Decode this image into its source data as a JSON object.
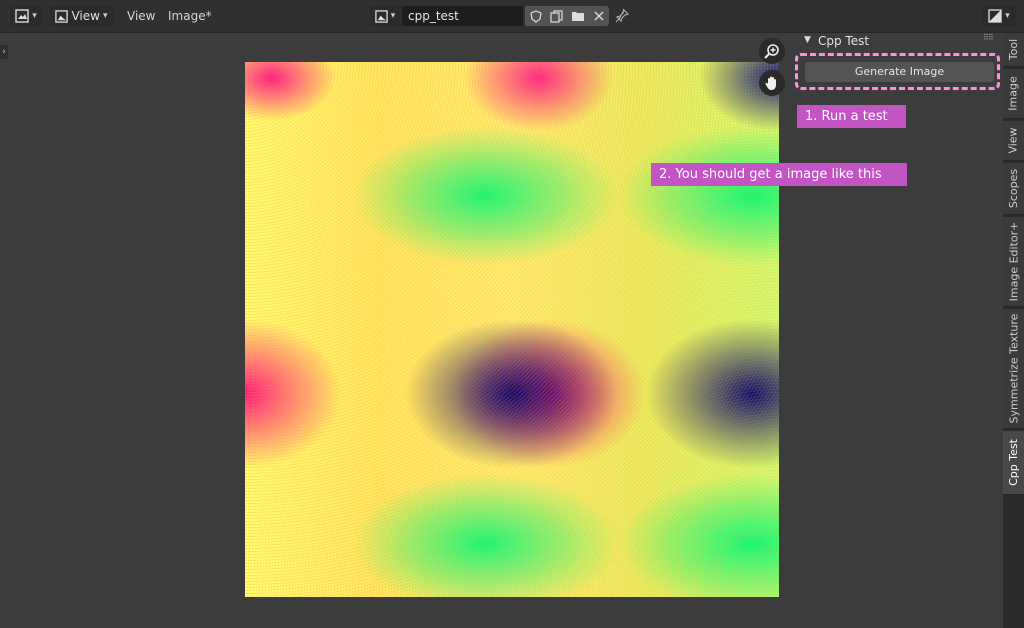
{
  "header": {
    "view_menu": "View",
    "view_label": "View",
    "image_menu": "Image*",
    "image_name": "cpp_test"
  },
  "panel": {
    "title": "Cpp Test",
    "generate_label": "Generate Image"
  },
  "annotations": {
    "step1": "1. Run a test",
    "step2": "2. You should get a image like this"
  },
  "tabs": [
    {
      "label": "Tool"
    },
    {
      "label": "Image"
    },
    {
      "label": "View"
    },
    {
      "label": "Scopes"
    },
    {
      "label": "Image Editor+"
    },
    {
      "label": "Symmetrize Texture"
    },
    {
      "label": "Cpp Test"
    }
  ],
  "colors": {
    "annotation_bg": "#c254c4",
    "highlight": "#ff8fe6"
  },
  "icons": {
    "editor_type": "image-editor-icon",
    "zoom": "zoom-in-icon",
    "pan": "hand-icon"
  }
}
